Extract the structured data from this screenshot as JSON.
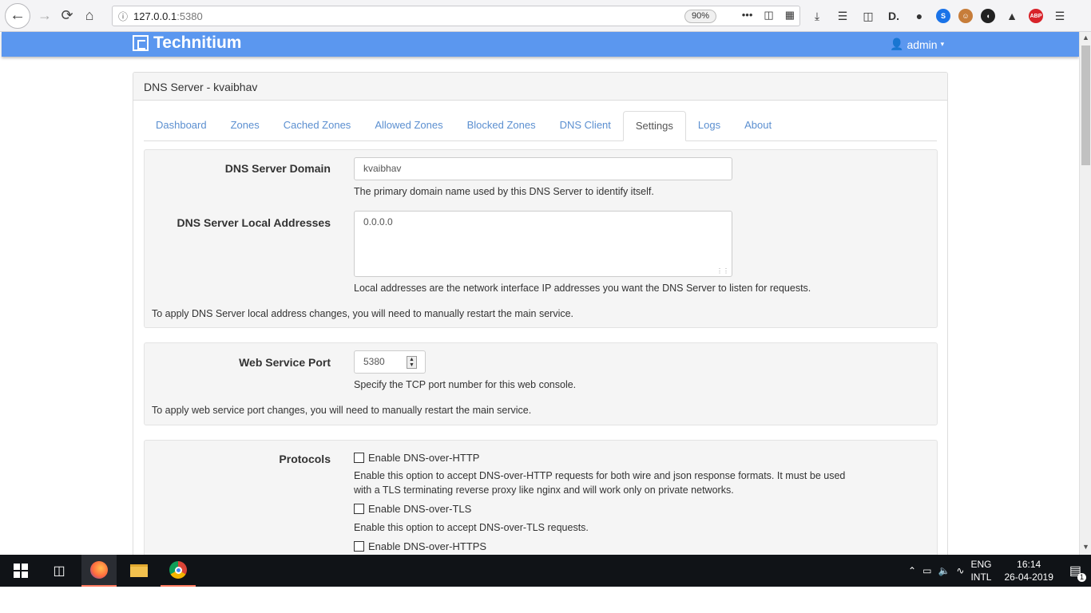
{
  "browser": {
    "url_host": "127.0.0.1",
    "url_port": ":5380",
    "zoom": "90%",
    "more": "•••"
  },
  "app": {
    "brand": "Technitium",
    "user": "admin"
  },
  "panel": {
    "heading": "DNS Server - kvaibhav",
    "tabs": [
      "Dashboard",
      "Zones",
      "Cached Zones",
      "Allowed Zones",
      "Blocked Zones",
      "DNS Client",
      "Settings",
      "Logs",
      "About"
    ],
    "active_tab": "Settings"
  },
  "settings": {
    "domain_label": "DNS Server Domain",
    "domain_value": "kvaibhav",
    "domain_help": "The primary domain name used by this DNS Server to identify itself.",
    "local_label": "DNS Server Local Addresses",
    "local_value": "0.0.0.0",
    "local_help": "Local addresses are the network interface IP addresses you want the DNS Server to listen for requests.",
    "local_note": "To apply DNS Server local address changes, you will need to manually restart the main service.",
    "port_label": "Web Service Port",
    "port_value": "5380",
    "port_help": "Specify the TCP port number for this web console.",
    "port_note": "To apply web service port changes, you will need to manually restart the main service.",
    "protocols_label": "Protocols",
    "doh_label": "Enable DNS-over-HTTP",
    "doh_help_1": "Enable this option to accept DNS-over-HTTP requests for both wire and json response formats. It must be used",
    "doh_help_2": "with a TLS terminating reverse proxy like nginx and will work only on private networks.",
    "dot_label": "Enable DNS-over-TLS",
    "dot_help": "Enable this option to accept DNS-over-TLS requests.",
    "dohs_label": "Enable DNS-over-HTTPS"
  },
  "taskbar": {
    "lang_1": "ENG",
    "lang_2": "INTL",
    "time": "16:14",
    "date": "26-04-2019",
    "notif_count": "1"
  }
}
